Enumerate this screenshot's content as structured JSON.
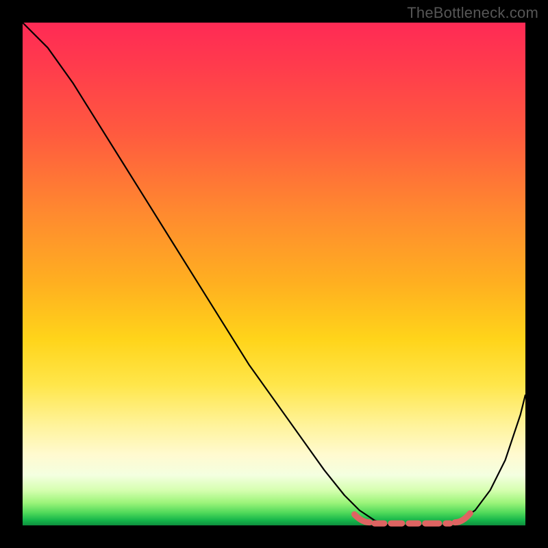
{
  "attribution": "TheBottleneck.com",
  "colors": {
    "background": "#000000",
    "text": "#565656",
    "curve": "#000000",
    "highlight": "#de6462",
    "gradient_top": "#ff2a55",
    "gradient_bottom": "#0f8f3e"
  },
  "chart_data": {
    "type": "line",
    "title": "",
    "xlabel": "",
    "ylabel": "",
    "xlim": [
      0,
      100
    ],
    "ylim": [
      0,
      100
    ],
    "note": "Axes are unlabeled; x and y normalized 0-100. y=100 at top (red), y=0 at bottom (green). Curve depicts a bottleneck-style V shape with a flat optimal trough around x≈71-86.",
    "series": [
      {
        "name": "curve",
        "x": [
          0,
          5,
          10,
          15,
          20,
          25,
          30,
          35,
          40,
          45,
          50,
          55,
          60,
          64,
          67,
          70,
          73,
          76,
          80,
          84,
          87,
          90,
          93,
          96,
          99,
          100
        ],
        "y": [
          100,
          95,
          88,
          80,
          72,
          64,
          56,
          48,
          40,
          32,
          25,
          18,
          11,
          6,
          3,
          1,
          0,
          0,
          0,
          0,
          1,
          3,
          7,
          13,
          22,
          26
        ]
      }
    ],
    "highlight_region": {
      "description": "trough markers (salmon dots/segments) along the curve bottom",
      "x_start": 66,
      "x_end": 89,
      "y_approx": 0
    }
  }
}
